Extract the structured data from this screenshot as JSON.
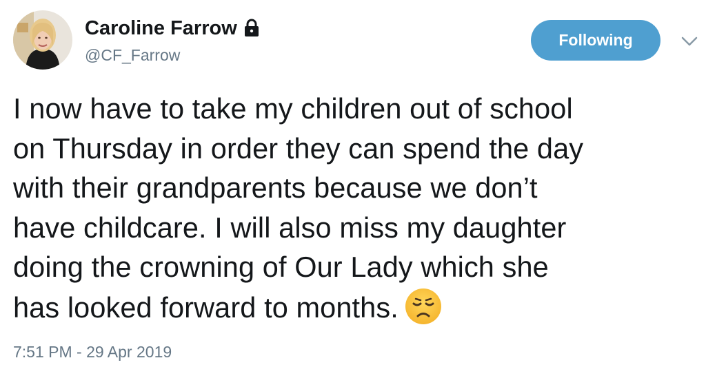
{
  "author": {
    "display_name": "Caroline Farrow",
    "handle": "@CF_Farrow",
    "protected_icon": "lock-icon",
    "avatar_icon": "user-avatar"
  },
  "follow_button": {
    "label": "Following"
  },
  "menu": {
    "icon": "chevron-down-icon"
  },
  "tweet": {
    "lines": [
      "I now have to take my children out of school",
      "on Thursday in order they can spend the day",
      "with their grandparents because we don’t",
      "have childcare. I will also miss my daughter",
      "doing the crowning of Our Lady which she",
      "has looked forward to months."
    ],
    "emoji": "disappointed-face-emoji",
    "timestamp": "7:51 PM - 29 Apr 2019"
  },
  "colors": {
    "accent": "#4f9fd0",
    "text": "#14171a",
    "muted": "#657786"
  }
}
